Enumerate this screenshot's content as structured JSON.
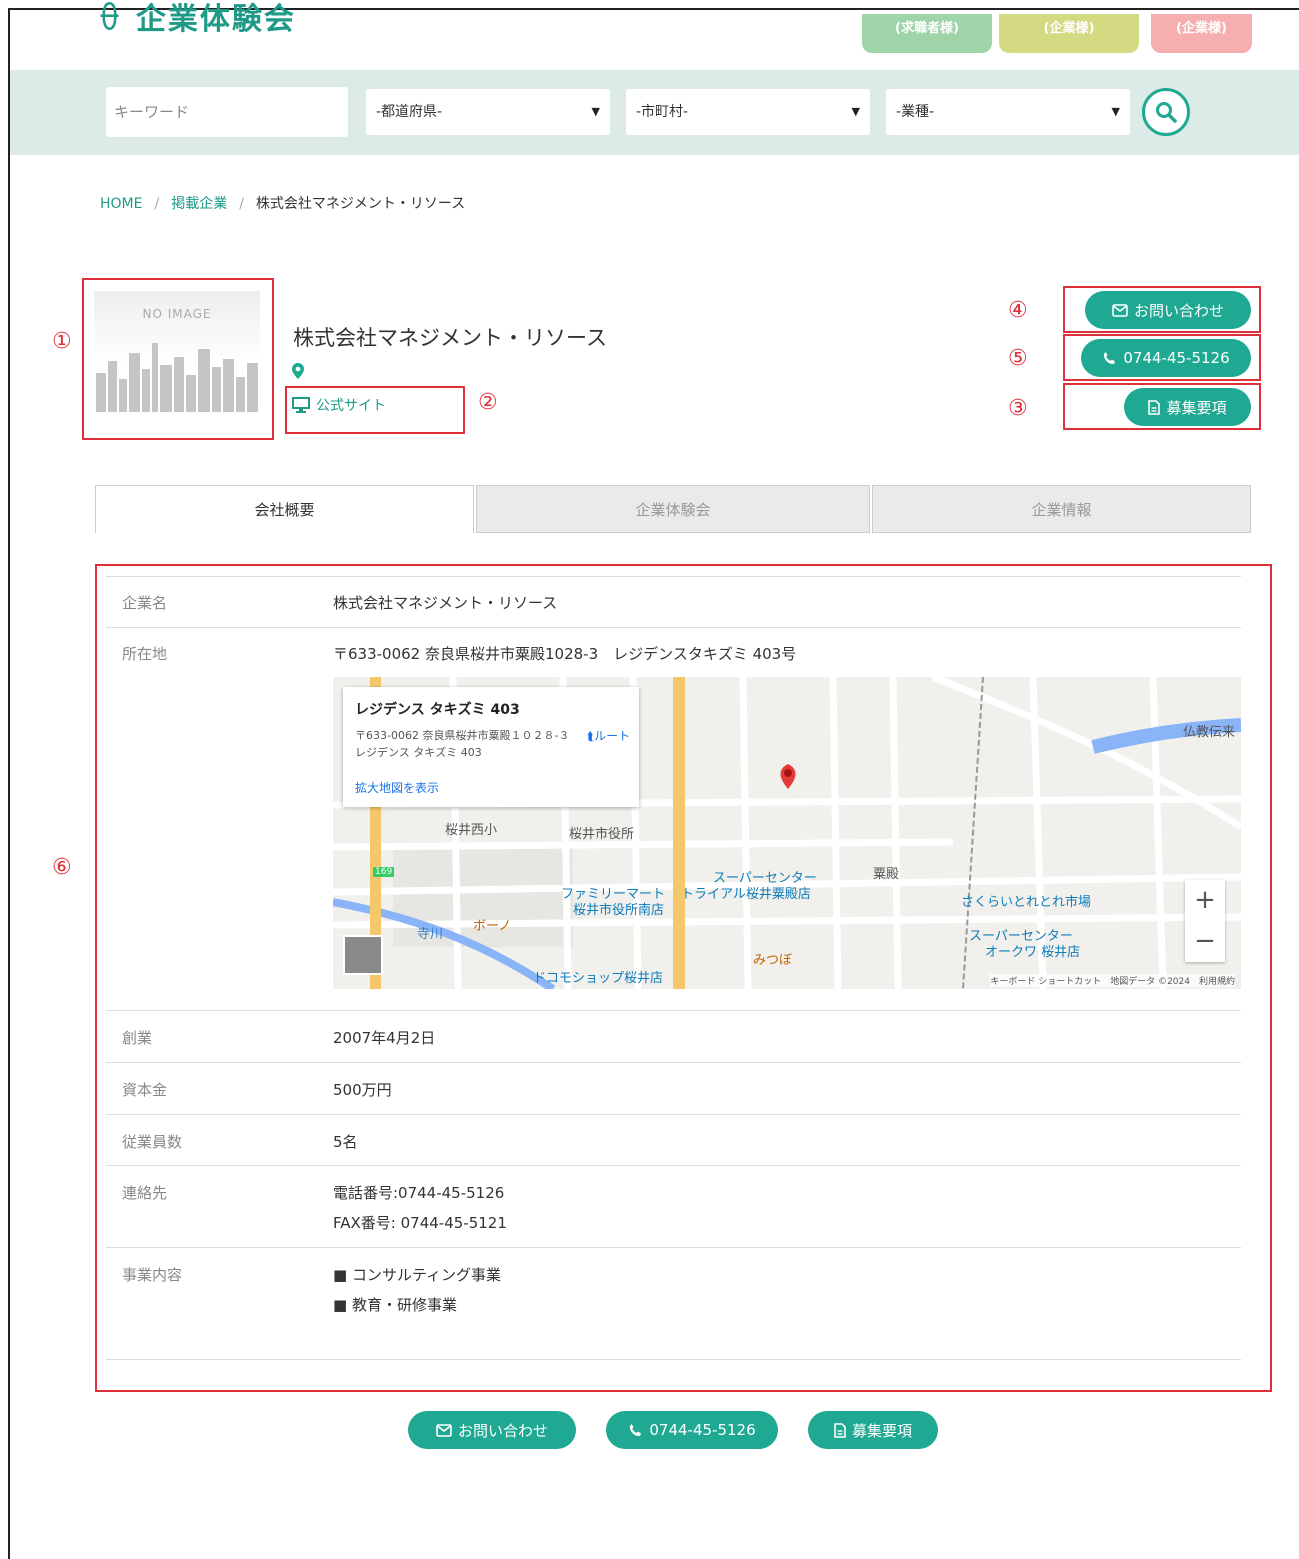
{
  "header": {
    "logo_text": "企業体験会",
    "top_buttons": [
      {
        "label": "(求職者様)",
        "color": "#9fd3a8"
      },
      {
        "label": "(企業様)",
        "color": "#d4da82"
      },
      {
        "label": "(企業様)",
        "color": "#f6aeae"
      }
    ]
  },
  "search": {
    "keyword_placeholder": "キーワード",
    "prefecture": "-都道府県-",
    "city": "-市町村-",
    "industry": "-業種-"
  },
  "breadcrumb": {
    "home": "HOME",
    "section": "掲載企業",
    "current": "株式会社マネジメント・リソース",
    "sep": "/"
  },
  "annotations": {
    "n1": "①",
    "n2": "②",
    "n3": "③",
    "n4": "④",
    "n5": "⑤",
    "n6": "⑥"
  },
  "company": {
    "no_image_text": "NO IMAGE",
    "name": "株式会社マネジメント・リソース",
    "official_site": "公式サイト"
  },
  "actions": {
    "contact": "お問い合わせ",
    "phone": "0744-45-5126",
    "recruit": "募集要項"
  },
  "tabs": [
    "会社概要",
    "企業体験会",
    "企業情報"
  ],
  "details": {
    "name_label": "企業名",
    "name_value": "株式会社マネジメント・リソース",
    "address_label": "所在地",
    "address_value": "〒633-0062 奈良県桜井市粟殿1028-3　レジデンスタキズミ 403号",
    "founded_label": "創業",
    "founded_value": "2007年4月2日",
    "capital_label": "資本金",
    "capital_value": "500万円",
    "employees_label": "従業員数",
    "employees_value": "5名",
    "contact_label": "連絡先",
    "contact_tel": "電話番号:0744-45-5126",
    "contact_fax": "FAX番号: 0744-45-5121",
    "business_label": "事業内容",
    "business_1": "■ コンサルティング事業",
    "business_2": "■ 教育・研修事業"
  },
  "map": {
    "card_name": "レジデンス タキズミ 403",
    "card_address": "〒633-0062 奈良県桜井市粟殿１０２８-３ レジデンス タキズミ 403",
    "card_route": "ルート",
    "card_link": "拡大地図を表示",
    "labels": {
      "l1": "桜井西小",
      "l2": "桜井市役所",
      "l3": "スーパーセンター",
      "l4": "トライアル桜井粟殿店",
      "l5": "ファミリーマート",
      "l6": "桜井市役所南店",
      "l7": "粟殿",
      "l8": "さくらいとれとれ市場",
      "l9": "スーパーセンター",
      "l10": "オークワ 桜井店",
      "l11": "ボーノ",
      "l12": "ドコモショップ桜井店",
      "l13": "みつぼ",
      "l14": "仏教伝来",
      "l15": "寺川",
      "l16": "169"
    },
    "footer": "キーボード ショートカット　地図データ ©2024　利用規約"
  }
}
